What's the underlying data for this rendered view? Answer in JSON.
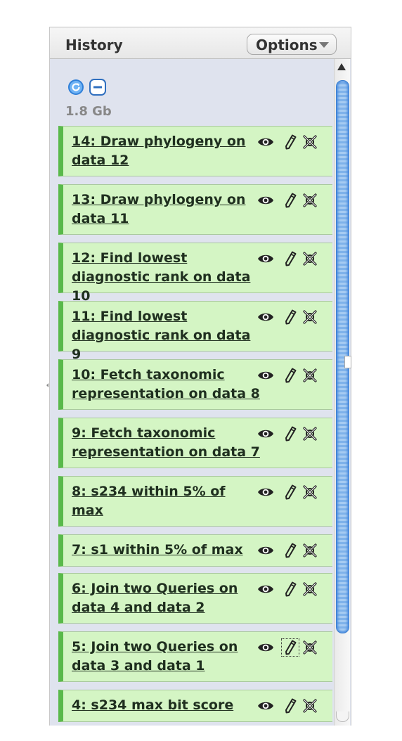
{
  "panel": {
    "title": "History",
    "options_label": "Options",
    "size": "1.8 Gb"
  },
  "icons": {
    "refresh": "refresh-icon",
    "collapse": "collapse-icon",
    "view": "eye-icon",
    "edit": "pencil-icon",
    "delete": "delete-icon"
  },
  "colors": {
    "dataset_ok_bg": "#d4f5c4",
    "dataset_ok_border": "#59b94a",
    "panel_bg": "#dfe3ee",
    "scroll_thumb": "#7fb2ea"
  },
  "datasets": [
    {
      "label": "14: Draw phylogeny on data 12"
    },
    {
      "label": "13: Draw phylogeny on data 11"
    },
    {
      "label": "12: Find lowest diagnostic rank on data 10"
    },
    {
      "label": "11: Find lowest diagnostic rank on data 9"
    },
    {
      "label": "10: Fetch taxonomic representation on data 8"
    },
    {
      "label": "9: Fetch taxonomic representation on data 7"
    },
    {
      "label": "8: s234 within 5% of max"
    },
    {
      "label": "7: s1 within 5% of max"
    },
    {
      "label": "6: Join two Queries on data 4 and data 2"
    },
    {
      "label": "5: Join two Queries on data 3 and data 1"
    },
    {
      "label": "4: s234 max bit score"
    }
  ]
}
